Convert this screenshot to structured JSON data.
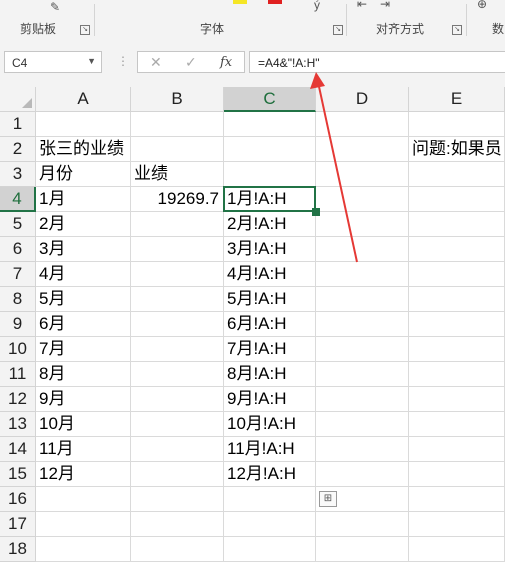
{
  "ribbon": {
    "groups": [
      "剪贴板",
      "字体",
      "对齐方式",
      "数"
    ]
  },
  "formula_bar": {
    "name_box": "C4",
    "cancel_icon": "✕",
    "enter_icon": "✓",
    "fx_label": "fx",
    "formula": "=A4&\"!A:H\""
  },
  "sheet": {
    "columns": [
      "A",
      "B",
      "C",
      "D",
      "E"
    ],
    "rows": [
      "1",
      "2",
      "3",
      "4",
      "5",
      "6",
      "7",
      "8",
      "9",
      "10",
      "11",
      "12",
      "13",
      "14",
      "15",
      "16",
      "17",
      "18"
    ],
    "cells": {
      "A2": "张三的业绩",
      "E2": "问题:如果员",
      "A3": "月份",
      "B3": "业绩",
      "A4": "1月",
      "B4": "19269.7",
      "C4": "1月!A:H",
      "A5": "2月",
      "C5": "2月!A:H",
      "A6": "3月",
      "C6": "3月!A:H",
      "A7": "4月",
      "C7": "4月!A:H",
      "A8": "5月",
      "C8": "5月!A:H",
      "A9": "6月",
      "C9": "6月!A:H",
      "A10": "7月",
      "C10": "7月!A:H",
      "A11": "8月",
      "C11": "8月!A:H",
      "A12": "9月",
      "C12": "9月!A:H",
      "A13": "10月",
      "C13": "10月!A:H",
      "A14": "11月",
      "C14": "11月!A:H",
      "A15": "12月",
      "C15": "12月!A:H"
    },
    "active_cell": "C4",
    "accent_color": "#217346",
    "annotation_color": "#e53935"
  }
}
